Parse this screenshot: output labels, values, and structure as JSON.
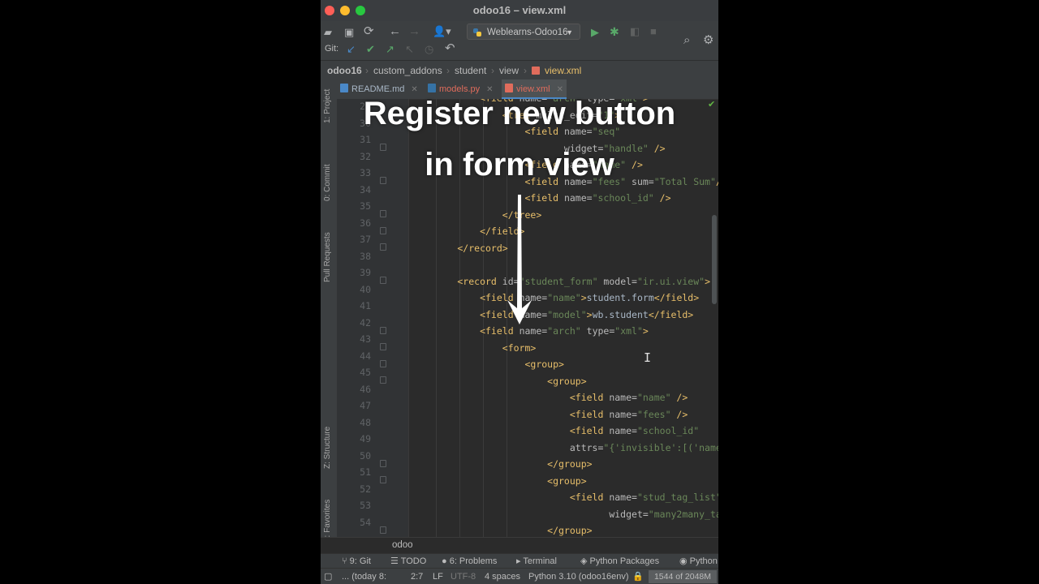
{
  "window": {
    "title": "odoo16 – view.xml"
  },
  "toolbar": {
    "run_config": "Weblearns-Odoo16",
    "git_label": "Git:"
  },
  "breadcrumb": [
    "odoo16",
    "custom_addons",
    "student",
    "view",
    "view.xml"
  ],
  "tabs": [
    {
      "label": "README.md",
      "color": "#4a88c7"
    },
    {
      "label": "models.py",
      "color": "#3572a5"
    },
    {
      "label": "view.xml",
      "color": "#e06c5c"
    }
  ],
  "left_tool_tabs": [
    "1: Project",
    "0: Commit",
    "Pull Requests",
    "Z: Structure",
    "2: Favorites"
  ],
  "editor": {
    "line_numbers": [
      "29",
      "30",
      "31",
      "32",
      "33",
      "34",
      "35",
      "36",
      "37",
      "38",
      "39",
      "40",
      "41",
      "42",
      "43",
      "44",
      "45",
      "46",
      "47",
      "48",
      "49",
      "50",
      "51",
      "52",
      "53",
      "54"
    ]
  },
  "overlay": {
    "line1": "Register new button",
    "line2": "in form view"
  },
  "bottom_crumb": "odoo",
  "tool_windows": [
    "9: Git",
    "TODO",
    "6: Problems",
    "Terminal",
    "Python Packages",
    "Python"
  ],
  "status": {
    "git": "... (today 8:",
    "position": "2:7",
    "line_sep": "LF",
    "encoding": "UTF-8",
    "indent": "4 spaces",
    "interpreter": "Python 3.10 (odoo16env)",
    "memory": "1544 of 2048M"
  }
}
